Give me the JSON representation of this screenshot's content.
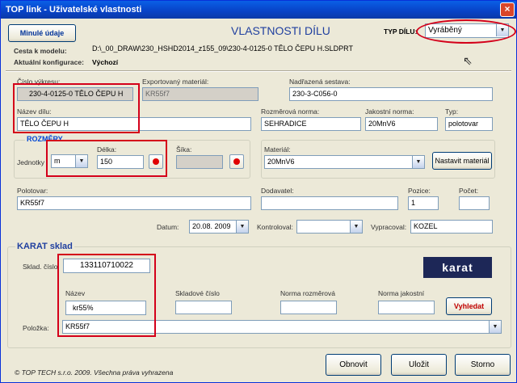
{
  "window": {
    "title": "TOP link - Uživatelské vlastnosti",
    "close": "×"
  },
  "header": {
    "prev_button": "Minulé údaje",
    "heading": "VLASTNOSTI DÍLU",
    "type_label": "TYP DÍLU:",
    "type_value": "Vyráběný",
    "model_path_label": "Cesta k modelu:",
    "model_path": "D:\\_00_DRAW\\230_HSHD2014_z155_09\\230-4-0125-0 TĚLO ČEPU H.SLDPRT",
    "config_label": "Aktuální konfigurace:",
    "config_value": "Výchozí"
  },
  "fields": {
    "drawing_no_label": "Číslo výkresu:",
    "drawing_no": "230-4-0125-0 TĚLO ČEPU H",
    "exported_material_label": "Exportovaný materiál:",
    "exported_material": "KR55f7",
    "parent_assembly_label": "Nadřazená sestava:",
    "parent_assembly": "230-3-C056-0",
    "part_name_label": "Název dílu:",
    "part_name": "TĚLO ČEPU H",
    "dim_norm_label": "Rozměrová norma:",
    "dim_norm": "SEHRADICE",
    "quality_norm_label": "Jakostní norma:",
    "quality_norm": "20MnV6",
    "type_label": "Typ:",
    "type": "polotovar"
  },
  "dimensions": {
    "group_title": "ROZMĚRY",
    "units_label": "Jednotky",
    "units_value": "m",
    "length_label": "Délka:",
    "length": "150",
    "width_label": "Šíka:",
    "width": ""
  },
  "material": {
    "label": "Materiál:",
    "value": "20MnV6",
    "set_button": "Nastavit materiál"
  },
  "row3": {
    "semi_label": "Polotovar:",
    "semi": "KR55f7",
    "supplier_label": "Dodavatel:",
    "supplier": "",
    "position_label": "Pozice:",
    "position": "1",
    "count_label": "Počet:",
    "count": ""
  },
  "row4": {
    "date_label": "Datum:",
    "date": "20.08. 2009",
    "checked_label": "Kontroloval:",
    "checked": "",
    "made_label": "Vypracoval:",
    "made": "KOZEL"
  },
  "karat": {
    "title": "KARAT sklad",
    "logo": "karat",
    "stock_no_label": "Sklad. číslo",
    "stock_no": "133110710022",
    "name_label": "Název",
    "name": "kr55%",
    "stock_code_label": "Skladové číslo",
    "stock_code": "",
    "dim_norm_label": "Norma rozměrová",
    "dim_norm": "",
    "quality_norm_label": "Norma jakostní",
    "quality_norm": "",
    "search_button": "Vyhledat",
    "item_label": "Položka:",
    "item": "KR55f7"
  },
  "footer": {
    "copyright": "© TOP TECH s.r.o. 2009. Všechna práva vyhrazena",
    "refresh": "Obnovit",
    "save": "Uložit",
    "cancel": "Storno"
  },
  "colors": {
    "title_bar": "#0a5fe6",
    "accent_red": "#d4001a",
    "legend_blue": "#0046d5"
  }
}
